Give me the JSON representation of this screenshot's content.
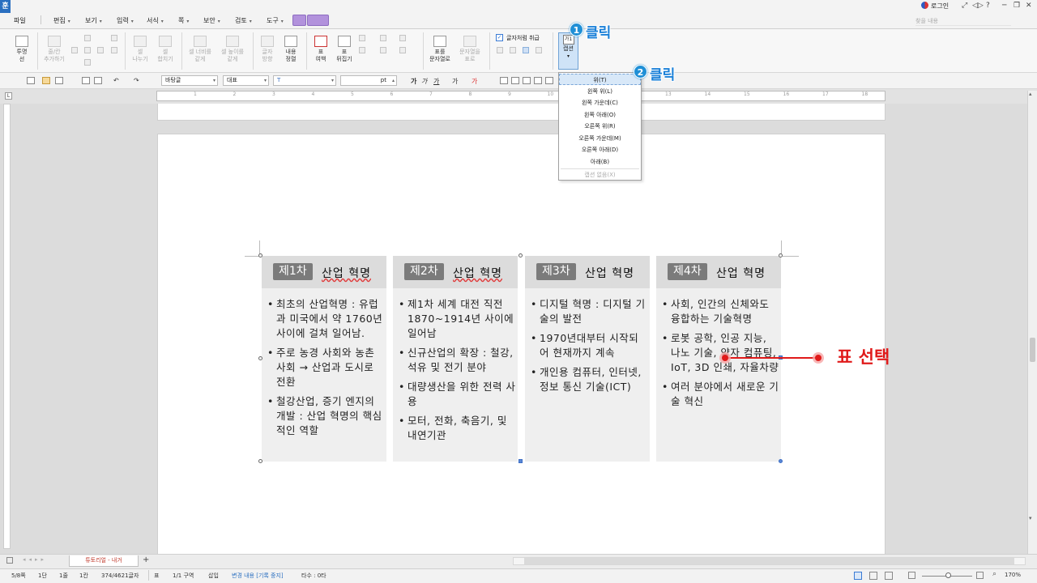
{
  "app": {
    "logo": "훈"
  },
  "menubar": {
    "items": [
      {
        "label": "파일",
        "has_dropdown": false
      },
      {
        "label": "편집",
        "has_dropdown": true
      },
      {
        "label": "보기",
        "has_dropdown": true
      },
      {
        "label": "입력",
        "has_dropdown": true
      },
      {
        "label": "서식",
        "has_dropdown": true
      },
      {
        "label": "쪽",
        "has_dropdown": true
      },
      {
        "label": "보안",
        "has_dropdown": true
      },
      {
        "label": "검토",
        "has_dropdown": true
      },
      {
        "label": "도구",
        "has_dropdown": true
      }
    ],
    "login": "로그인",
    "search_placeholder": "찾을 내용",
    "window_controls": [
      "⤢",
      "◁▷",
      "?",
      "─",
      "❐",
      "✕"
    ]
  },
  "ribbon": {
    "buttons": [
      {
        "label1": "투명",
        "label2": "선",
        "enabled": true
      },
      {
        "label1": "줄/칸",
        "label2": "추가하기",
        "enabled": false
      },
      {
        "label1": "셀",
        "label2": "나누기",
        "enabled": false
      },
      {
        "label1": "셀",
        "label2": "합치기",
        "enabled": false
      },
      {
        "label1": "셀 너비를",
        "label2": "같게",
        "enabled": false
      },
      {
        "label1": "셀 높이를",
        "label2": "같게",
        "enabled": false
      },
      {
        "label1": "글자",
        "label2": "방향",
        "enabled": false
      },
      {
        "label1": "내용",
        "label2": "정렬",
        "enabled": true
      },
      {
        "label1": "표",
        "label2": "여백",
        "enabled": true
      },
      {
        "label1": "표",
        "label2": "뒤집기",
        "enabled": true
      },
      {
        "label1": "표를",
        "label2": "문자열로",
        "enabled": true
      },
      {
        "label1": "문자열을",
        "label2": "표로",
        "enabled": false
      }
    ],
    "checkbox_label": "글자처럼 취급",
    "checkbox_checked": true,
    "caption_button": {
      "icon_text": "가1",
      "label": "캡션"
    }
  },
  "format_toolbar": {
    "style": "바탕글",
    "lang": "대표",
    "font": "",
    "size_unit": "pt"
  },
  "ruler_numbers": [
    "1",
    "2",
    "3",
    "4",
    "5",
    "6",
    "7",
    "8",
    "9",
    "10",
    "11",
    "12",
    "13",
    "14",
    "15",
    "16",
    "17",
    "18"
  ],
  "caption_menu": {
    "items": [
      {
        "label": "위(T)",
        "highlighted": true,
        "disabled": false
      },
      {
        "label": "왼쪽 위(L)",
        "highlighted": false,
        "disabled": false
      },
      {
        "label": "왼쪽 가운데(C)",
        "highlighted": false,
        "disabled": false
      },
      {
        "label": "왼쪽 아래(O)",
        "highlighted": false,
        "disabled": false
      },
      {
        "label": "오른쪽 위(R)",
        "highlighted": false,
        "disabled": false
      },
      {
        "label": "오른쪽 가운데(M)",
        "highlighted": false,
        "disabled": false
      },
      {
        "label": "오른쪽 아래(D)",
        "highlighted": false,
        "disabled": false
      },
      {
        "label": "아래(B)",
        "highlighted": false,
        "disabled": false
      },
      {
        "label": "캡션 없음(X)",
        "highlighted": false,
        "disabled": true
      }
    ]
  },
  "table": {
    "columns": [
      {
        "badge": "제1차",
        "title": "산업 혁명",
        "bullets": [
          "최초의 산업혁명 : 유럽과 미국에서 약 1760년사이에 걸쳐 일어남.",
          "주로 농경 사회와 농촌 사회 → 산업과 도시로 전환",
          "철강산업, 증기 엔지의 개발 : 산업 혁명의 핵심적인 역할"
        ]
      },
      {
        "badge": "제2차",
        "title": "산업 혁명",
        "bullets": [
          "제1차 세계 대전 직전 1870~1914년 사이에 일어남",
          "신규산업의 확장 : 철강, 석유 및 전기 분야",
          "대량생산을 위한 전력 사용",
          "모터, 전화, 축음기, 및 내연기관"
        ]
      },
      {
        "badge": "제3차",
        "title": "산업 혁명",
        "bullets": [
          "디지털 혁명 : 디지털 기술의 발전",
          "1970년대부터 시작되어 현재까지 계속",
          "개인용 컴퓨터, 인터넷, 정보 통신 기술(ICT)"
        ]
      },
      {
        "badge": "제4차",
        "title": "산업 혁명",
        "bullets": [
          "사회, 인간의 신체와도 융합하는 기술혁명",
          "로봇 공학, 인공 지능, 나노 기술, 양자 컴퓨팅, IoT, 3D 인쇄, 자율차량",
          "여러 분야에서 새로운 기술 혁신"
        ]
      }
    ]
  },
  "annotations": {
    "step1_num": "1",
    "step1_text": "클릭",
    "step2_num": "2",
    "step2_text": "클릭",
    "pyo_label": "표 선택"
  },
  "tabbar": {
    "doc_tab": "튜토리얼 - 내거",
    "add": "+"
  },
  "statusbar": {
    "page": "5/8쪽",
    "dan": "1단",
    "line": "1줄",
    "col": "1칸",
    "chars": "374/4621글자",
    "obj": "표",
    "section": "1/1 구역",
    "mode": "삽입",
    "change": "변경 내용 [기록 중지]",
    "typo": "타수 : 0타",
    "zoom": "170%"
  },
  "colors": {
    "accent_blue": "#1a80d8",
    "red_annotation": "#e01a1a",
    "table_header_bg": "#dcdcdc",
    "table_body_bg": "#efefef",
    "badge_bg": "#7b7b7b",
    "purple": "#b292dc"
  }
}
